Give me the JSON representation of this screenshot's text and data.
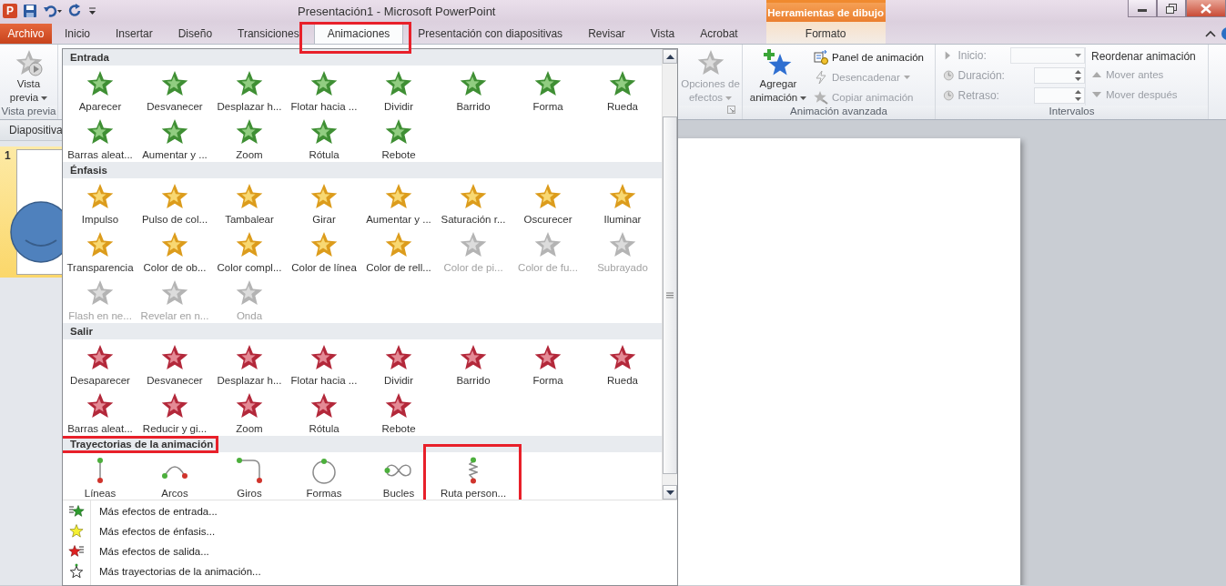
{
  "window": {
    "app_letter": "P",
    "title": "Presentación1 - Microsoft PowerPoint"
  },
  "tabs": [
    {
      "label": "Archivo",
      "kind": "file",
      "selected": false,
      "highlighted": false
    },
    {
      "label": "Inicio",
      "kind": "tab",
      "selected": false,
      "highlighted": false
    },
    {
      "label": "Insertar",
      "kind": "tab",
      "selected": false,
      "highlighted": false
    },
    {
      "label": "Diseño",
      "kind": "tab",
      "selected": false,
      "highlighted": false
    },
    {
      "label": "Transiciones",
      "kind": "tab",
      "selected": false,
      "highlighted": false
    },
    {
      "label": "Animaciones",
      "kind": "tab",
      "selected": true,
      "highlighted": true
    },
    {
      "label": "Presentación con diapositivas",
      "kind": "tab",
      "selected": false,
      "highlighted": false
    },
    {
      "label": "Revisar",
      "kind": "tab",
      "selected": false,
      "highlighted": false
    },
    {
      "label": "Vista",
      "kind": "tab",
      "selected": false,
      "highlighted": false
    },
    {
      "label": "Acrobat",
      "kind": "tab",
      "selected": false,
      "highlighted": false
    }
  ],
  "contextual": {
    "title": "Herramientas de dibujo",
    "tabs": [
      {
        "label": "Formato",
        "selected": false
      }
    ]
  },
  "ribbon": {
    "preview": {
      "button": "Vista previa",
      "group": "Vista previa"
    },
    "effect_options": {
      "label": "Opciones de efectos",
      "disabled": true
    },
    "advanced": {
      "group": "Animación avanzada",
      "add_button": "Agregar animación",
      "commands": [
        {
          "label": "Panel de animación",
          "kind": "pane",
          "disabled": false,
          "dropdown": false
        },
        {
          "label": "Desencadenar",
          "kind": "trigger",
          "disabled": true,
          "dropdown": true
        },
        {
          "label": "Copiar animación",
          "kind": "painter",
          "disabled": true,
          "dropdown": false
        }
      ]
    },
    "timing": {
      "group": "Intervalos",
      "fields": [
        {
          "label": "Inicio:",
          "kind": "dropdown",
          "disabled": true
        },
        {
          "label": "Duración:",
          "kind": "spinner",
          "disabled": true
        },
        {
          "label": "Retraso:",
          "kind": "spinner",
          "disabled": true
        }
      ]
    },
    "reorder": {
      "title": "Reordenar animación",
      "commands": [
        {
          "label": "Mover antes",
          "kind": "up",
          "disabled": true
        },
        {
          "label": "Mover después",
          "kind": "down",
          "disabled": true
        }
      ]
    }
  },
  "slides_panel": {
    "tab": "Diapositiva",
    "slides": [
      {
        "number": "1",
        "selected": true
      }
    ]
  },
  "gallery": {
    "sections": [
      {
        "title": "Entrada",
        "kind": "entrance",
        "highlighted": false,
        "items": [
          {
            "label": "Aparecer",
            "disabled": false,
            "highlighted": false
          },
          {
            "label": "Desvanecer",
            "disabled": false,
            "highlighted": false
          },
          {
            "label": "Desplazar h...",
            "disabled": false,
            "highlighted": false
          },
          {
            "label": "Flotar hacia ...",
            "disabled": false,
            "highlighted": false
          },
          {
            "label": "Dividir",
            "disabled": false,
            "highlighted": false
          },
          {
            "label": "Barrido",
            "disabled": false,
            "highlighted": false
          },
          {
            "label": "Forma",
            "disabled": false,
            "highlighted": false
          },
          {
            "label": "Rueda",
            "disabled": false,
            "highlighted": false
          },
          {
            "label": "Barras aleat...",
            "disabled": false,
            "highlighted": false
          },
          {
            "label": "Aumentar y ...",
            "disabled": false,
            "highlighted": false
          },
          {
            "label": "Zoom",
            "disabled": false,
            "highlighted": false
          },
          {
            "label": "Rótula",
            "disabled": false,
            "highlighted": false
          },
          {
            "label": "Rebote",
            "disabled": false,
            "highlighted": false
          }
        ]
      },
      {
        "title": "Énfasis",
        "kind": "emphasis",
        "highlighted": false,
        "items": [
          {
            "label": "Impulso",
            "disabled": false,
            "highlighted": false
          },
          {
            "label": "Pulso de col...",
            "disabled": false,
            "highlighted": false
          },
          {
            "label": "Tambalear",
            "disabled": false,
            "highlighted": false
          },
          {
            "label": "Girar",
            "disabled": false,
            "highlighted": false
          },
          {
            "label": "Aumentar y ...",
            "disabled": false,
            "highlighted": false
          },
          {
            "label": "Saturación r...",
            "disabled": false,
            "highlighted": false
          },
          {
            "label": "Oscurecer",
            "disabled": false,
            "highlighted": false
          },
          {
            "label": "Iluminar",
            "disabled": false,
            "highlighted": false
          },
          {
            "label": "Transparencia",
            "disabled": false,
            "highlighted": false
          },
          {
            "label": "Color de ob...",
            "disabled": false,
            "highlighted": false
          },
          {
            "label": "Color compl...",
            "disabled": false,
            "highlighted": false
          },
          {
            "label": "Color de línea",
            "disabled": false,
            "highlighted": false
          },
          {
            "label": "Color de rell...",
            "disabled": false,
            "highlighted": false
          },
          {
            "label": "Color de pi...",
            "disabled": true,
            "highlighted": false
          },
          {
            "label": "Color de fu...",
            "disabled": true,
            "highlighted": false
          },
          {
            "label": "Subrayado",
            "disabled": true,
            "highlighted": false
          },
          {
            "label": "Flash en ne...",
            "disabled": true,
            "highlighted": false
          },
          {
            "label": "Revelar en n...",
            "disabled": true,
            "highlighted": false
          },
          {
            "label": "Onda",
            "disabled": true,
            "highlighted": false
          }
        ]
      },
      {
        "title": "Salir",
        "kind": "exit",
        "highlighted": false,
        "items": [
          {
            "label": "Desaparecer",
            "disabled": false,
            "highlighted": false
          },
          {
            "label": "Desvanecer",
            "disabled": false,
            "highlighted": false
          },
          {
            "label": "Desplazar h...",
            "disabled": false,
            "highlighted": false
          },
          {
            "label": "Flotar hacia ...",
            "disabled": false,
            "highlighted": false
          },
          {
            "label": "Dividir",
            "disabled": false,
            "highlighted": false
          },
          {
            "label": "Barrido",
            "disabled": false,
            "highlighted": false
          },
          {
            "label": "Forma",
            "disabled": false,
            "highlighted": false
          },
          {
            "label": "Rueda",
            "disabled": false,
            "highlighted": false
          },
          {
            "label": "Barras aleat...",
            "disabled": false,
            "highlighted": false
          },
          {
            "label": "Reducir y gi...",
            "disabled": false,
            "highlighted": false
          },
          {
            "label": "Zoom",
            "disabled": false,
            "highlighted": false
          },
          {
            "label": "Rótula",
            "disabled": false,
            "highlighted": false
          },
          {
            "label": "Rebote",
            "disabled": false,
            "highlighted": false
          }
        ]
      },
      {
        "title": "Trayectorias de la animación",
        "kind": "path",
        "highlighted": true,
        "items": [
          {
            "label": "Líneas",
            "kind": "line",
            "disabled": false,
            "highlighted": false
          },
          {
            "label": "Arcos",
            "kind": "arc",
            "disabled": false,
            "highlighted": false
          },
          {
            "label": "Giros",
            "kind": "turn",
            "disabled": false,
            "highlighted": false
          },
          {
            "label": "Formas",
            "kind": "shape",
            "disabled": false,
            "highlighted": false
          },
          {
            "label": "Bucles",
            "kind": "loop",
            "disabled": false,
            "highlighted": false
          },
          {
            "label": "Ruta person...",
            "kind": "custom",
            "disabled": false,
            "highlighted": true
          }
        ]
      }
    ],
    "menu": [
      {
        "label": "Más efectos de entrada...",
        "kind": "entrance"
      },
      {
        "label": "Más efectos de énfasis...",
        "kind": "emphasis"
      },
      {
        "label": "Más efectos de salida...",
        "kind": "exit"
      },
      {
        "label": "Más trayectorias de la animación...",
        "kind": "path"
      }
    ]
  }
}
